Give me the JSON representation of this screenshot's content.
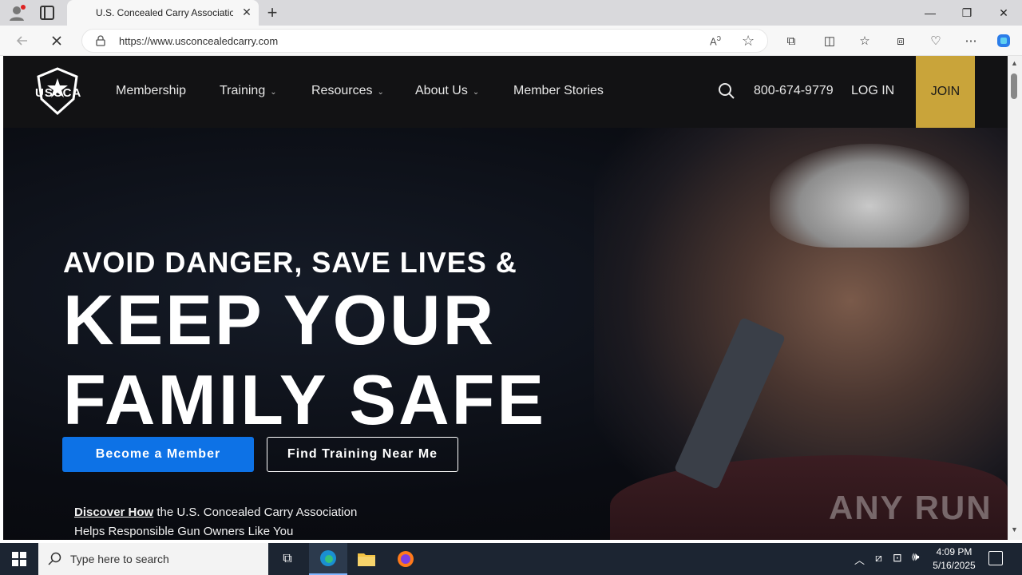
{
  "browser": {
    "tab_title": "U.S. Concealed Carry Association",
    "tab_close": "✕",
    "new_tab": "+",
    "url": "https://www.usconcealedcarry.com",
    "window_controls": {
      "minimize": "—",
      "restore": "❐",
      "close": "✕"
    }
  },
  "site": {
    "logo_text": "USCCA",
    "nav": {
      "items": [
        {
          "label": "Membership",
          "has_dropdown": false
        },
        {
          "label": "Training",
          "has_dropdown": true
        },
        {
          "label": "Resources",
          "has_dropdown": true
        },
        {
          "label": "About Us",
          "has_dropdown": true
        },
        {
          "label": "Member Stories",
          "has_dropdown": false
        }
      ],
      "chevron": "⌄",
      "phone": "800-674-9779",
      "login": "LOG IN",
      "join": "JOIN"
    },
    "hero": {
      "eyebrow": "AVOID DANGER, SAVE LIVES &",
      "headline_line1": "KEEP YOUR",
      "headline_line2": "FAMILY SAFE",
      "cta_primary": "Become a Member",
      "cta_secondary": "Find Training Near Me",
      "discover_link": "Discover How",
      "discover_text_1": " the U.S. Concealed Carry Association",
      "discover_text_2": "Helps Responsible Gun Owners Like You"
    },
    "watermark": "ANY RUN"
  },
  "taskbar": {
    "search_placeholder": "Type here to search",
    "time": "4:09 PM",
    "date": "5/16/2025"
  },
  "colors": {
    "join_gold": "#c9a43a",
    "cta_blue": "#0d72e6",
    "nav_bg": "#121214",
    "taskbar": "#1c2532"
  }
}
